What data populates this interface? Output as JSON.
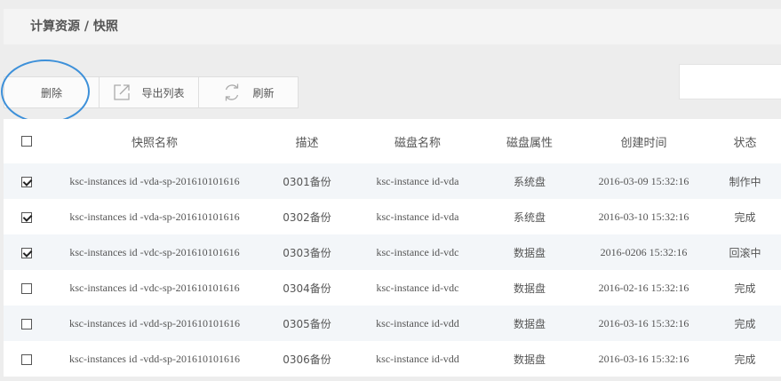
{
  "header": {
    "breadcrumb": "计算资源 / 快照"
  },
  "toolbar": {
    "delete_label": "删除",
    "export_label": "导出列表",
    "refresh_label": "刷新"
  },
  "table": {
    "columns": [
      "快照名称",
      "描述",
      "磁盘名称",
      "磁盘属性",
      "创建时间",
      "状态"
    ],
    "rows": [
      {
        "checked": true,
        "name": "ksc-instances id -vda-sp-201610101616",
        "desc": "0301备份",
        "disk": "ksc-instance id-vda",
        "attr": "系统盘",
        "time": "2016-03-09 15:32:16",
        "status": "制作中"
      },
      {
        "checked": true,
        "name": "ksc-instances id -vda-sp-201610101616",
        "desc": "0302备份",
        "disk": "ksc-instance id-vda",
        "attr": "系统盘",
        "time": "2016-03-10 15:32:16",
        "status": "完成"
      },
      {
        "checked": true,
        "name": "ksc-instances id -vdc-sp-201610101616",
        "desc": "0303备份",
        "disk": "ksc-instance id-vdc",
        "attr": "数据盘",
        "time": "2016-0206 15:32:16",
        "status": "回滚中"
      },
      {
        "checked": false,
        "name": "ksc-instances id -vdc-sp-201610101616",
        "desc": "0304备份",
        "disk": "ksc-instance id-vdc",
        "attr": "数据盘",
        "time": "2016-02-16 15:32:16",
        "status": "完成"
      },
      {
        "checked": false,
        "name": "ksc-instances id -vdd-sp-201610101616",
        "desc": "0305备份",
        "disk": "ksc-instance id-vdd",
        "attr": "数据盘",
        "time": "2016-03-16 15:32:16",
        "status": "完成"
      },
      {
        "checked": false,
        "name": "ksc-instances id -vdd-sp-201610101616",
        "desc": "0306备份",
        "disk": "ksc-instance id-vdd",
        "attr": "数据盘",
        "time": "2016-03-16 15:32:16",
        "status": "完成"
      }
    ]
  },
  "colors": {
    "highlight_circle": "#3d90d9",
    "stripe": "#f3f6f9"
  }
}
